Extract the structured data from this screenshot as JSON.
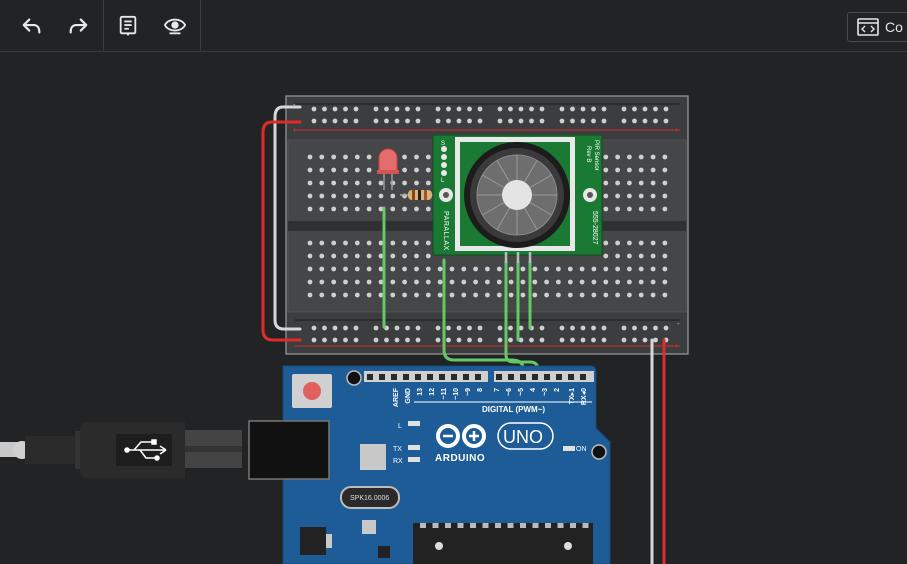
{
  "toolbar": {
    "undo_icon": "undo-arrow-icon",
    "redo_icon": "redo-arrow-icon",
    "notes_icon": "notes-icon",
    "visibility_icon": "eye-icon",
    "code_button_label": "Co",
    "code_icon": "code-editor-icon"
  },
  "colors": {
    "background": "#222324",
    "breadboard": "#3b3d3f",
    "arduino_board": "#1d5c96",
    "pir_board": "#1a7a33",
    "wire_green": "#64c864",
    "wire_red": "#e02b2b",
    "wire_white": "#d7d7d7"
  },
  "sensor": {
    "top_label": "PIR Sensor",
    "top_label_rev": "Rev B",
    "brand": "PARALLAX",
    "part_number": "555-28027",
    "pins_left": [
      "S",
      "L"
    ]
  },
  "arduino": {
    "logo_text": "ARDUINO",
    "model": "UNO",
    "digital_label": "DIGITAL (PWM~)",
    "pin_labels": [
      "AREF",
      "GND",
      "13",
      "12",
      "~11",
      "~10",
      "~9",
      "8",
      "7",
      "~6",
      "~5",
      "4",
      "~3",
      "2",
      "TX▸1",
      "RX◂0"
    ],
    "led_l": "L",
    "led_tx": "TX",
    "led_rx": "RX",
    "led_on": "ON",
    "crystal": "SPK16.0006"
  },
  "breadboard": {
    "rail_minus": "-",
    "rail_plus": "+"
  },
  "usb": {
    "symbol": "usb-icon"
  }
}
